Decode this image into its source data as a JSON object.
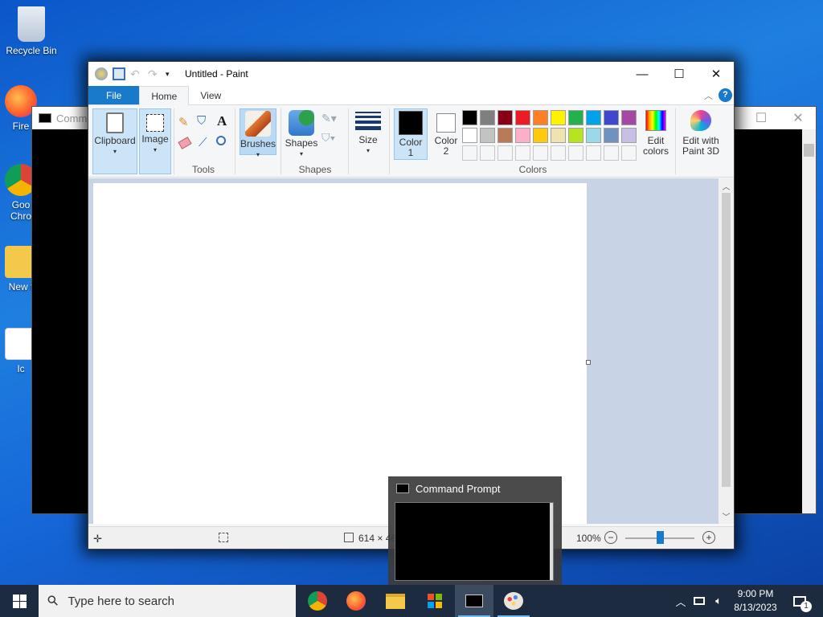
{
  "desktop": {
    "icons": [
      {
        "label": "Recycle Bin"
      },
      {
        "label": "Fire"
      },
      {
        "label": "Goo Chro"
      },
      {
        "label": "New f"
      },
      {
        "label": "Ic"
      }
    ]
  },
  "cmd_background": {
    "title": "Comm",
    "controls": {
      "maximize": "☐",
      "close": "✕"
    }
  },
  "paint": {
    "title": "Untitled - Paint",
    "controls": {
      "minimize": "—",
      "maximize": "☐",
      "close": "✕"
    },
    "tabs": [
      "File",
      "Home",
      "View"
    ],
    "ribbon": {
      "clipboard": "Clipboard",
      "image": "Image",
      "tools_group": "Tools",
      "brushes": "Brushes",
      "shapes_btn": "Shapes",
      "shapes_group": "Shapes",
      "size": "Size",
      "color1_l1": "Color",
      "color1_l2": "1",
      "color2_l1": "Color",
      "color2_l2": "2",
      "colors_group": "Colors",
      "edit_colors_l1": "Edit",
      "edit_colors_l2": "colors",
      "paint3d_l1": "Edit with",
      "paint3d_l2": "Paint 3D",
      "text_tool": "A"
    },
    "palette_row1": [
      "#000000",
      "#7f7f7f",
      "#880015",
      "#ed1c24",
      "#ff7f27",
      "#fff200",
      "#22b14c",
      "#00a2e8",
      "#3f48cc",
      "#a349a4"
    ],
    "palette_row2": [
      "#ffffff",
      "#c3c3c3",
      "#b97a57",
      "#ffaec9",
      "#ffc90e",
      "#efe4b0",
      "#b5e61d",
      "#99d9ea",
      "#7092be",
      "#c8bfe7"
    ],
    "color1": "#000000",
    "color2": "#ffffff",
    "status": {
      "size": "614 × 460px",
      "zoom": "100%"
    }
  },
  "taskbar": {
    "search_placeholder": "Type here to search",
    "thumbnail_title": "Command Prompt",
    "time": "9:00 PM",
    "date": "8/13/2023",
    "notifications": "1"
  }
}
